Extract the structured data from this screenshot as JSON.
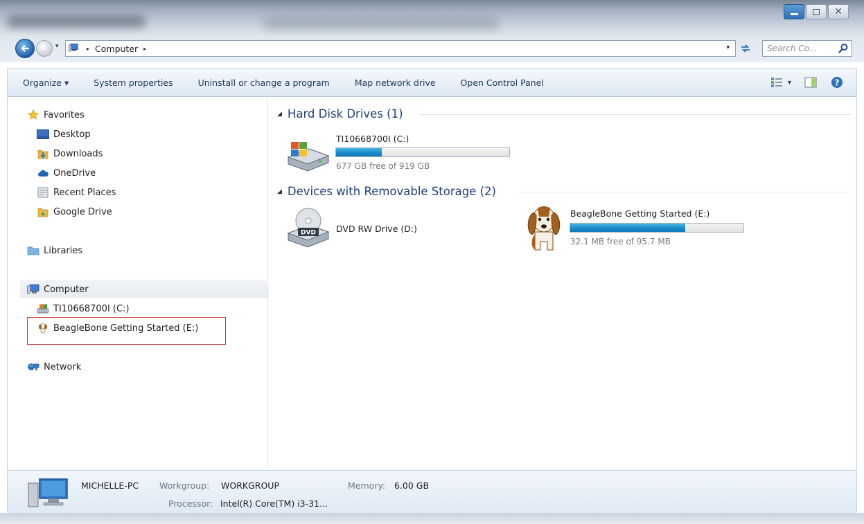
{
  "window": {
    "close_glyph": "✕"
  },
  "address": {
    "crumb": "Computer",
    "arrow": "▸",
    "dropdown": "▾",
    "history": "▾"
  },
  "search": {
    "placeholder": "Search Co..."
  },
  "toolbar": {
    "items": [
      "Organize ▾",
      "System properties",
      "Uninstall or change a program",
      "Map network drive",
      "Open Control Panel"
    ],
    "view_dropdown": "▾"
  },
  "nav": {
    "favorites": "Favorites",
    "desktop": "Desktop",
    "downloads": "Downloads",
    "onedrive": "OneDrive",
    "recent": "Recent Places",
    "gdrive": "Google Drive",
    "libraries": "Libraries",
    "computer": "Computer",
    "drive_c": "TI10668700I (C:)",
    "drive_e": "BeagleBone Getting Started (E:)",
    "network": "Network"
  },
  "content": {
    "hdd_group": "Hard Disk Drives (1)",
    "removable_group": "Devices with Removable Storage (2)",
    "group_toggle": "◢",
    "drive_c": {
      "name": "TI10668700I (C:)",
      "free": "677 GB free of 919 GB",
      "used_fraction": 0.263
    },
    "dvd": {
      "name": "DVD RW Drive (D:)",
      "label": "DVD"
    },
    "beagle": {
      "name": "BeagleBone Getting Started (E:)",
      "free": "32.1 MB free of 95.7 MB",
      "used_fraction": 0.665
    }
  },
  "details": {
    "pc_name": "MICHELLE-PC",
    "workgroup_label": "Workgroup:",
    "workgroup_value": "WORKGROUP",
    "memory_label": "Memory:",
    "memory_value": "6.00 GB",
    "processor_label": "Processor:",
    "processor_value": "Intel(R) Core(TM) i3-31..."
  },
  "colors": {
    "accent": "#1a8bc9",
    "highlight": "#c23b3b",
    "group_header": "#1e3f7a"
  }
}
